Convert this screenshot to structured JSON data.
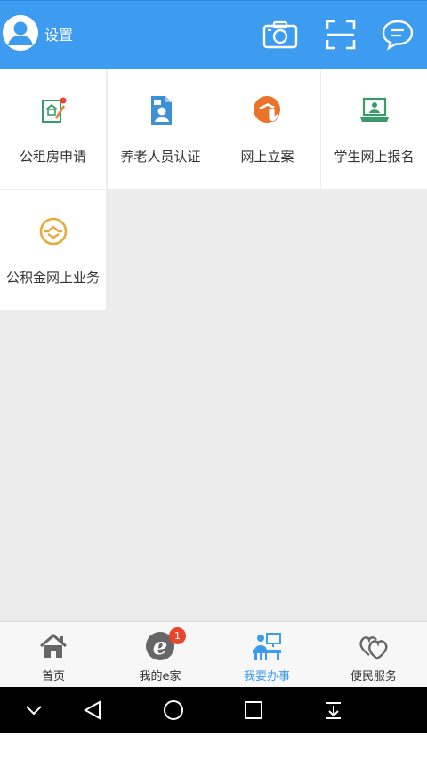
{
  "header": {
    "settings_label": "设置",
    "icons": [
      "avatar",
      "camera-icon",
      "scan-icon",
      "message-icon"
    ],
    "bg_color": "#3d9cf0"
  },
  "services": [
    {
      "label": "公租房申请",
      "icon": "house-application-icon"
    },
    {
      "label": "养老人员认证",
      "icon": "elder-certification-icon"
    },
    {
      "label": "网上立案",
      "icon": "online-filing-icon"
    },
    {
      "label": "学生网上报名",
      "icon": "student-registration-icon"
    },
    {
      "label": "公积金网上业务",
      "icon": "housing-fund-icon"
    }
  ],
  "tabbar": {
    "tabs": [
      {
        "label": "首页",
        "icon": "home-icon"
      },
      {
        "label": "我的e家",
        "icon": "e-home-icon",
        "badge": "1"
      },
      {
        "label": "我要办事",
        "icon": "service-desk-icon",
        "active": true
      },
      {
        "label": "便民服务",
        "icon": "hearts-icon"
      }
    ],
    "active_color": "#3d9cf0"
  },
  "system_nav": [
    "collapse-icon",
    "back-icon",
    "home-circle-icon",
    "recents-icon",
    "notification-pull-icon"
  ]
}
